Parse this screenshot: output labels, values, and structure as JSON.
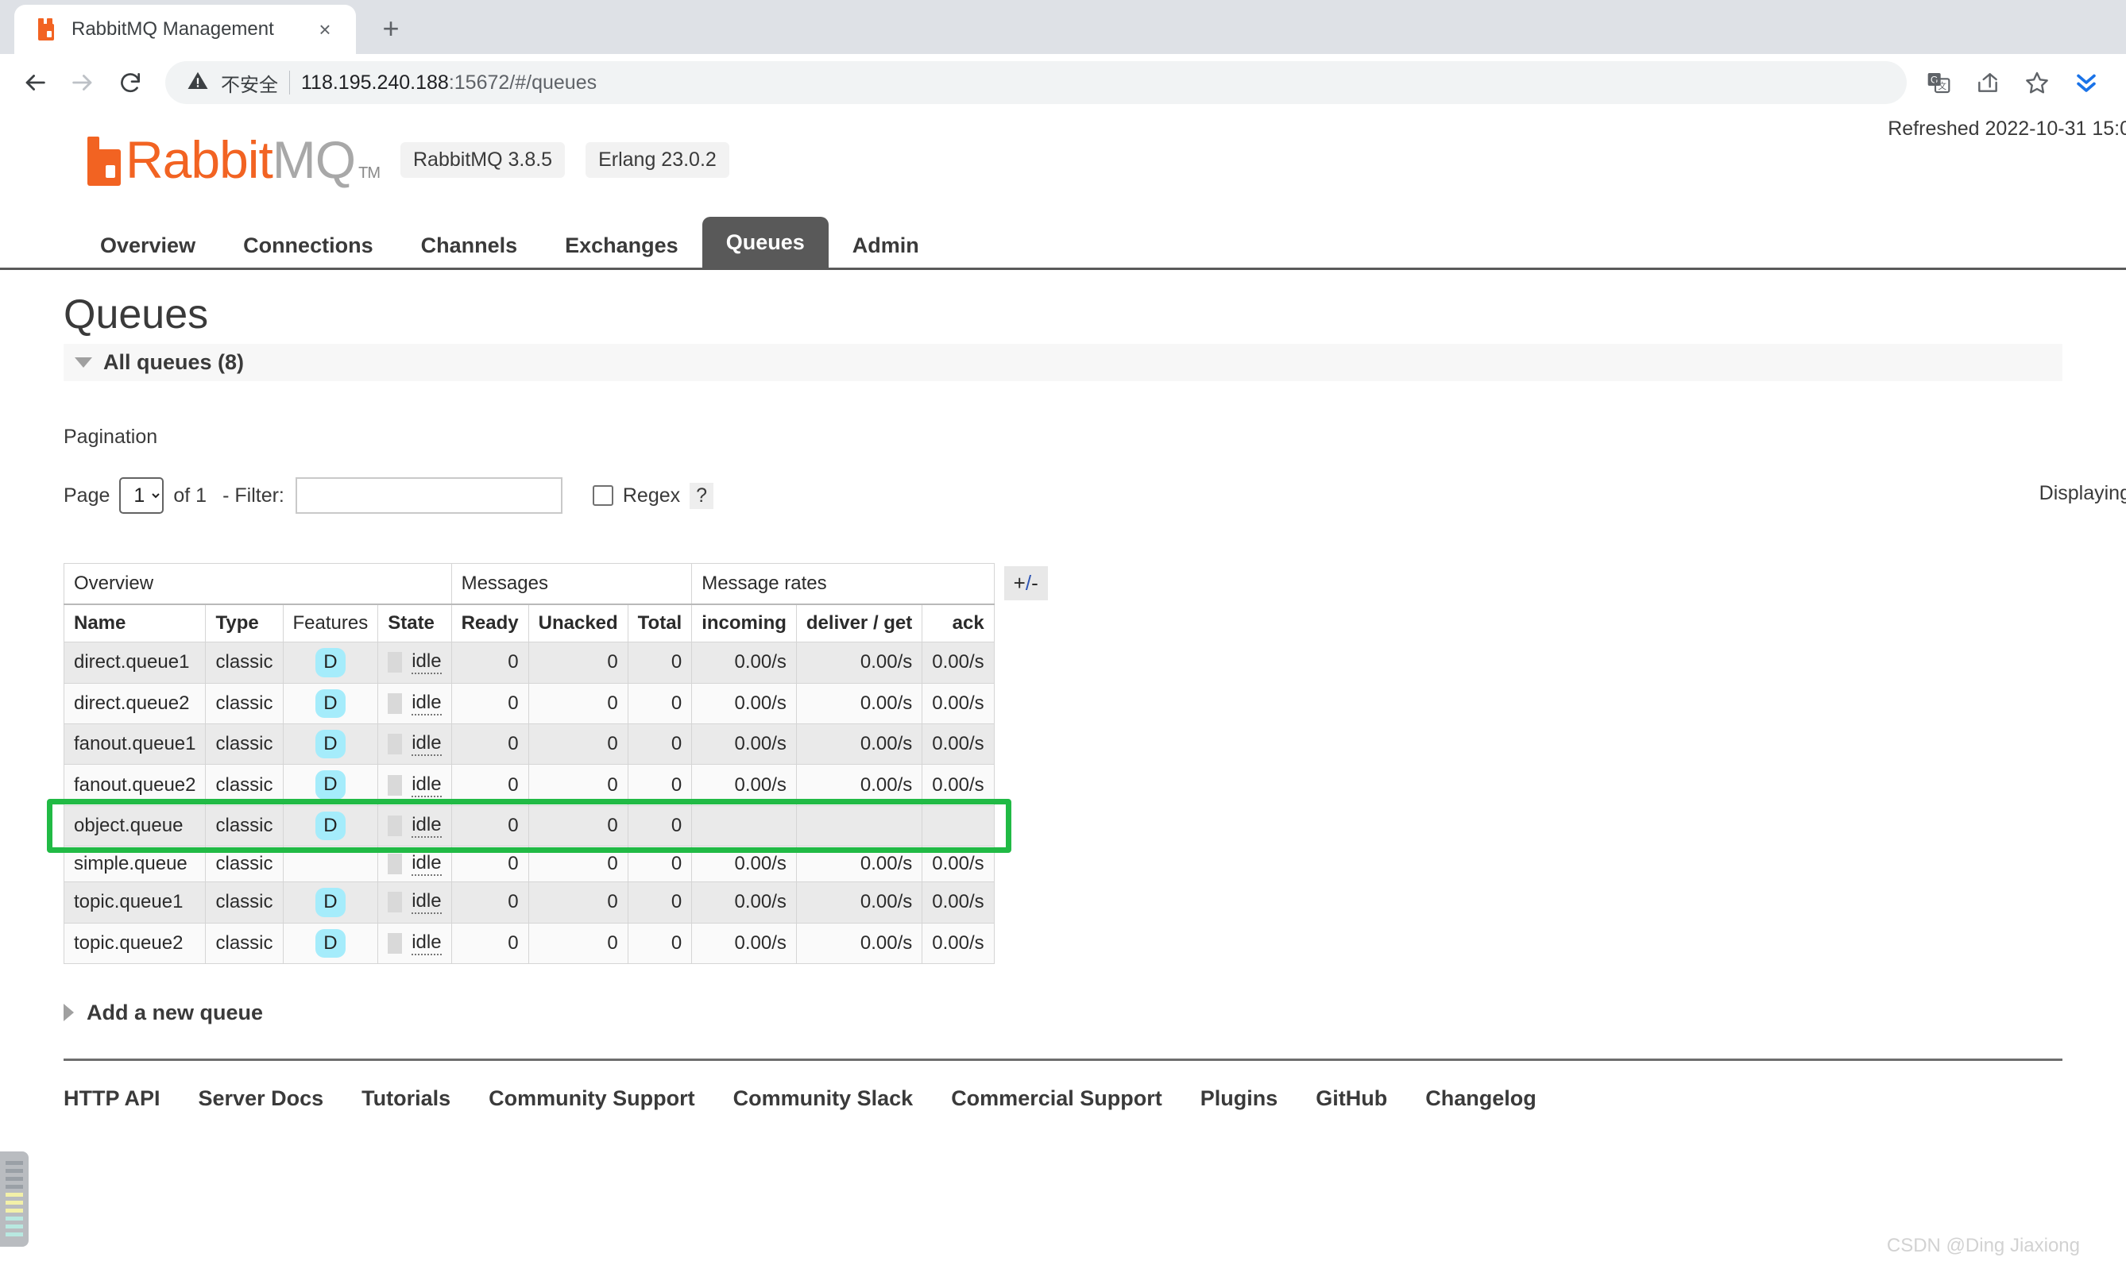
{
  "browser": {
    "tab": {
      "title": "RabbitMQ Management",
      "favicon": "rabbitmq-favicon",
      "close_label": "×"
    },
    "new_tab_label": "+",
    "omnibox": {
      "security_text": "不安全",
      "url_host": "118.195.240.188",
      "url_rest": ":15672/#/queues"
    },
    "icons": {
      "back": "back-arrow-icon",
      "forward": "forward-arrow-icon",
      "reload": "reload-icon",
      "translate": "translate-icon",
      "share": "share-icon",
      "bookmark": "star-icon",
      "extension": "chevrons-down-icon"
    }
  },
  "header": {
    "logo_rabbit": "Rabbit",
    "logo_mq": "MQ",
    "logo_tm": "TM",
    "version_pills": [
      "RabbitMQ 3.8.5",
      "Erlang 23.0.2"
    ],
    "refreshed": "Refreshed 2022-10-31 15:0"
  },
  "nav": {
    "tabs": [
      {
        "label": "Overview",
        "active": false
      },
      {
        "label": "Connections",
        "active": false
      },
      {
        "label": "Channels",
        "active": false
      },
      {
        "label": "Exchanges",
        "active": false
      },
      {
        "label": "Queues",
        "active": true
      },
      {
        "label": "Admin",
        "active": false
      }
    ]
  },
  "main": {
    "page_title": "Queues",
    "section_header": "All queues (8)",
    "pagination_label": "Pagination",
    "pager": {
      "page_word": "Page",
      "page_value": "1",
      "of_text": "of 1",
      "filter_label": "- Filter:",
      "filter_value": "",
      "filter_placeholder": "",
      "regex_label": "Regex",
      "help_label": "?",
      "displaying": "Displaying"
    },
    "table": {
      "group_headers": [
        "Overview",
        "Messages",
        "Message rates"
      ],
      "columns": [
        "Name",
        "Type",
        "Features",
        "State",
        "Ready",
        "Unacked",
        "Total",
        "incoming",
        "deliver / get",
        "ack"
      ],
      "toggle_columns_label": "+/-",
      "rows": [
        {
          "name": "direct.queue1",
          "type": "classic",
          "features": "D",
          "state": "idle",
          "ready": "0",
          "unacked": "0",
          "total": "0",
          "incoming": "0.00/s",
          "deliver_get": "0.00/s",
          "ack": "0.00/s",
          "highlighted": false
        },
        {
          "name": "direct.queue2",
          "type": "classic",
          "features": "D",
          "state": "idle",
          "ready": "0",
          "unacked": "0",
          "total": "0",
          "incoming": "0.00/s",
          "deliver_get": "0.00/s",
          "ack": "0.00/s",
          "highlighted": false
        },
        {
          "name": "fanout.queue1",
          "type": "classic",
          "features": "D",
          "state": "idle",
          "ready": "0",
          "unacked": "0",
          "total": "0",
          "incoming": "0.00/s",
          "deliver_get": "0.00/s",
          "ack": "0.00/s",
          "highlighted": false
        },
        {
          "name": "fanout.queue2",
          "type": "classic",
          "features": "D",
          "state": "idle",
          "ready": "0",
          "unacked": "0",
          "total": "0",
          "incoming": "0.00/s",
          "deliver_get": "0.00/s",
          "ack": "0.00/s",
          "highlighted": false
        },
        {
          "name": "object.queue",
          "type": "classic",
          "features": "D",
          "state": "idle",
          "ready": "0",
          "unacked": "0",
          "total": "0",
          "incoming": "",
          "deliver_get": "",
          "ack": "",
          "highlighted": true
        },
        {
          "name": "simple.queue",
          "type": "classic",
          "features": "",
          "state": "idle",
          "ready": "0",
          "unacked": "0",
          "total": "0",
          "incoming": "0.00/s",
          "deliver_get": "0.00/s",
          "ack": "0.00/s",
          "highlighted": false
        },
        {
          "name": "topic.queue1",
          "type": "classic",
          "features": "D",
          "state": "idle",
          "ready": "0",
          "unacked": "0",
          "total": "0",
          "incoming": "0.00/s",
          "deliver_get": "0.00/s",
          "ack": "0.00/s",
          "highlighted": false
        },
        {
          "name": "topic.queue2",
          "type": "classic",
          "features": "D",
          "state": "idle",
          "ready": "0",
          "unacked": "0",
          "total": "0",
          "incoming": "0.00/s",
          "deliver_get": "0.00/s",
          "ack": "0.00/s",
          "highlighted": false
        }
      ]
    },
    "add_queue_label": "Add a new queue"
  },
  "footer": {
    "links": [
      "HTTP API",
      "Server Docs",
      "Tutorials",
      "Community Support",
      "Community Slack",
      "Commercial Support",
      "Plugins",
      "GitHub",
      "Changelog"
    ]
  },
  "watermark": "CSDN @Ding Jiaxiong",
  "colors": {
    "brand_orange": "#f26322",
    "active_tab_gray": "#595959",
    "durable_badge": "#a5ecfb",
    "highlight_green": "#21ba45"
  }
}
